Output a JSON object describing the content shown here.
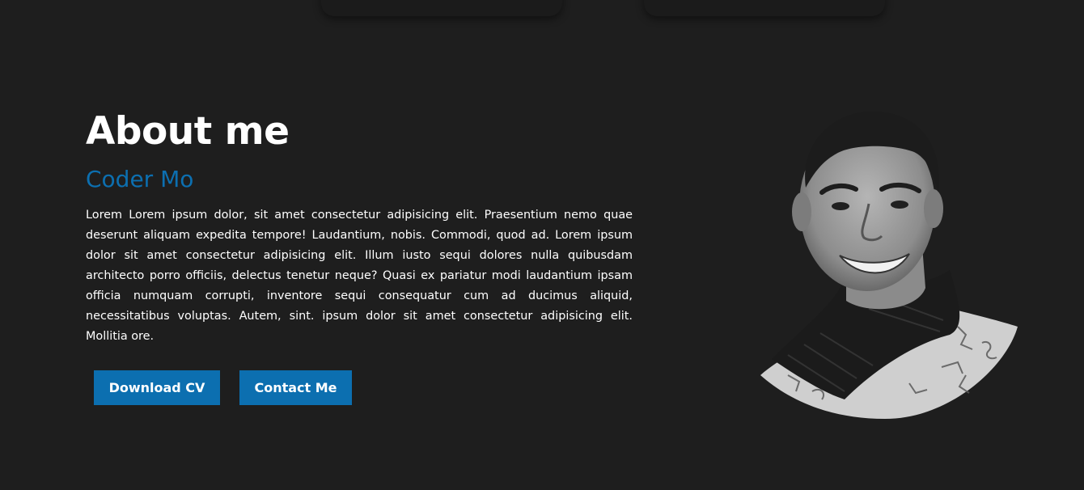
{
  "about": {
    "title": "About me",
    "subtitle": "Coder Mo",
    "description": "Lorem Lorem ipsum dolor, sit amet consectetur adipisicing elit. Praesentium nemo quae deserunt aliquam expedita tempore! Laudantium, nobis. Commodi, quod ad. Lorem ipsum dolor sit amet consectetur adipisicing elit. Illum iusto sequi dolores nulla quibusdam architecto porro officiis, delectus tenetur neque? Quasi ex pariatur modi laudantium ipsam officia numquam corrupti, inventore sequi consequatur cum ad ducimus aliquid, necessitatibus voluptas. Autem, sint. ipsum dolor sit amet consectetur adipisicing elit. Mollitia ore."
  },
  "buttons": {
    "download_cv": "Download CV",
    "contact_me": "Contact Me"
  },
  "colors": {
    "background": "#1e1e1e",
    "accent": "#0c6fb0",
    "text": "#ffffff"
  },
  "portrait": {
    "icon": "profile-photo"
  }
}
